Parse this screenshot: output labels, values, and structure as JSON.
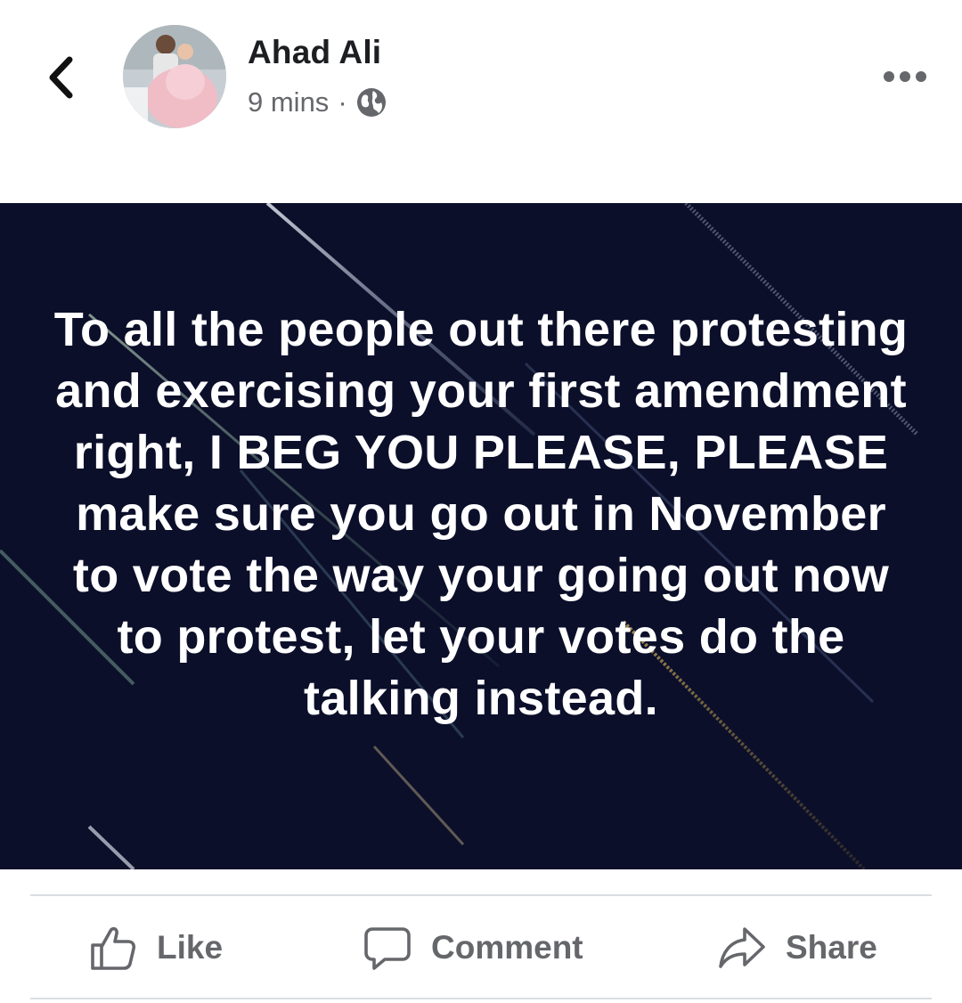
{
  "post": {
    "author": "Ahad Ali",
    "time": "9 mins",
    "separator": "·",
    "visibility_icon": "globe-icon",
    "text": "To all the people out there protesting and exercising your first amendment right, I BEG YOU PLEASE, PLEASE make sure you go out in November to vote the way your going out now to protest, let your votes do the talking instead."
  },
  "actions": {
    "like": "Like",
    "comment": "Comment",
    "share": "Share"
  },
  "colors": {
    "image_background": "#0b0f2a",
    "meta_text": "#65676b",
    "divider": "#dadde1"
  }
}
